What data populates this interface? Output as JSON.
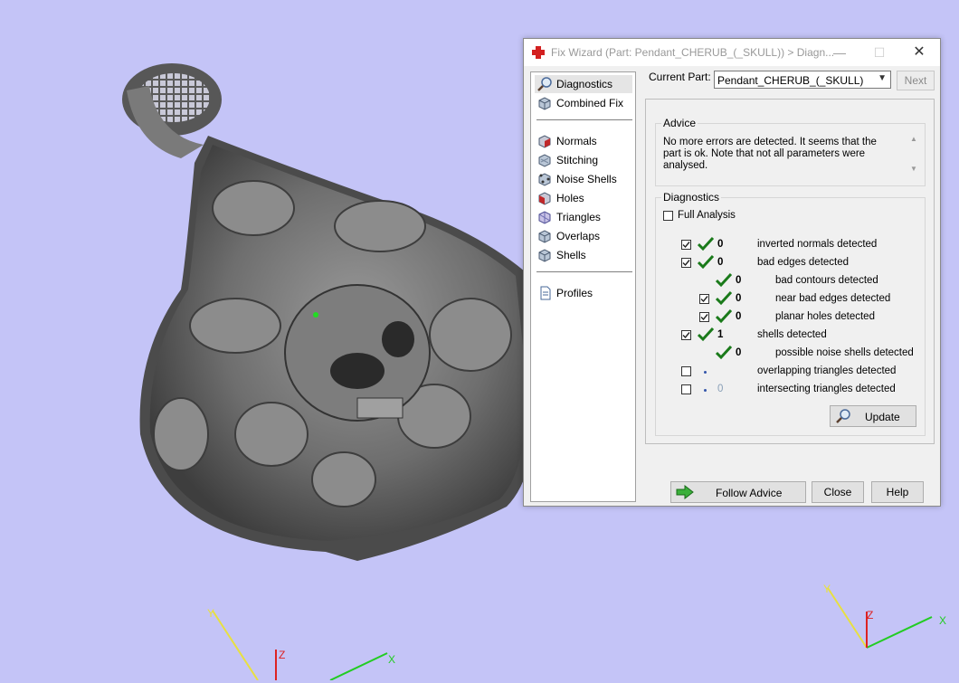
{
  "window": {
    "title": "Fix Wizard (Part: Pendant_CHERUB_(_SKULL)) > Diagn...",
    "minimize_glyph": "—",
    "maximize_glyph": "☐",
    "close_glyph": "✕"
  },
  "nav": {
    "top_items": [
      {
        "label": "Diagnostics",
        "icon": "magnifier-icon",
        "selected": true
      },
      {
        "label": "Combined Fix",
        "icon": "cube-icon",
        "selected": false
      }
    ],
    "fix_items": [
      {
        "label": "Normals",
        "icon": "normals-cube-icon"
      },
      {
        "label": "Stitching",
        "icon": "stitching-cube-icon"
      },
      {
        "label": "Noise Shells",
        "icon": "noise-shells-icon"
      },
      {
        "label": "Holes",
        "icon": "holes-cube-icon"
      },
      {
        "label": "Triangles",
        "icon": "triangles-cube-icon"
      },
      {
        "label": "Overlaps",
        "icon": "overlaps-cube-icon"
      },
      {
        "label": "Shells",
        "icon": "shells-cube-icon"
      }
    ],
    "profiles_label": "Profiles"
  },
  "current_part": {
    "label": "Current Part:",
    "value": "Pendant_CHERUB_(_SKULL)",
    "next_label": "Next"
  },
  "advice": {
    "title": "Advice",
    "text": "No more errors are detected. It seems that the part is ok. Note that not all parameters were analysed."
  },
  "diagnostics": {
    "title": "Diagnostics",
    "full_analysis_label": "Full Analysis",
    "rows": [
      {
        "checkbox": "checked",
        "status": "ok",
        "count": "0",
        "label": "inverted normals detected",
        "indent": 0
      },
      {
        "checkbox": "checked",
        "status": "ok",
        "count": "0",
        "label": "bad edges detected",
        "indent": 0
      },
      {
        "checkbox": "none",
        "status": "ok",
        "count": "0",
        "label": "bad contours detected",
        "indent": 1
      },
      {
        "checkbox": "checked",
        "status": "ok",
        "count": "0",
        "label": "near bad edges detected",
        "indent": 1
      },
      {
        "checkbox": "checked",
        "status": "ok",
        "count": "0",
        "label": "planar holes detected",
        "indent": 1
      },
      {
        "checkbox": "checked",
        "status": "ok",
        "count": "1",
        "label": "shells detected",
        "indent": 0
      },
      {
        "checkbox": "none",
        "status": "ok",
        "count": "0",
        "label": "possible noise shells detected",
        "indent": 1
      },
      {
        "checkbox": "unchecked",
        "status": "dot",
        "count": "",
        "label": "overlapping triangles detected",
        "indent": 0
      },
      {
        "checkbox": "unchecked",
        "status": "dot",
        "count": "0",
        "label": "intersecting triangles detected",
        "indent": 0
      }
    ],
    "update_label": "Update"
  },
  "footer": {
    "follow_advice_label": "Follow Advice",
    "close_label": "Close",
    "help_label": "Help"
  },
  "axes_left": {
    "x": "X",
    "y": "Y",
    "z": "Z"
  },
  "axes_right": {
    "x": "X",
    "y": "Y",
    "z": "Z"
  },
  "colors": {
    "background": "#c4c4f7",
    "model": "#6b6b6b",
    "check_green": "#1a7a1a",
    "axis_x": "#22cc22",
    "axis_y": "#e8e040",
    "axis_z": "#dd2222"
  }
}
